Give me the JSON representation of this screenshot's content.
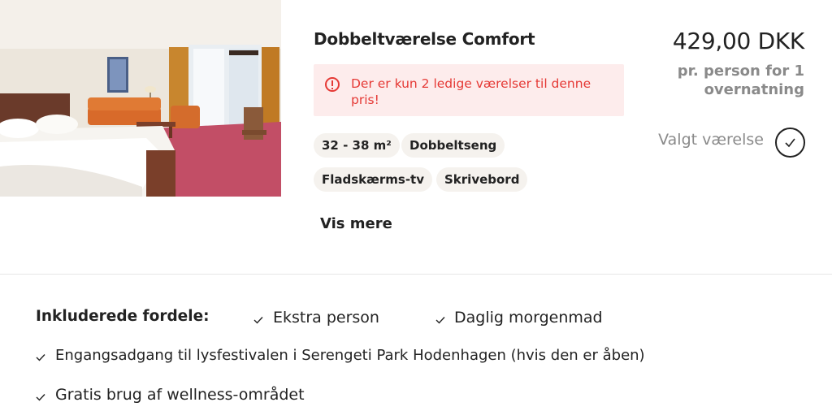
{
  "room": {
    "title": "Dobbeltværelse Comfort",
    "image_alt": "Hotelværelse med dobbeltseng",
    "alert": {
      "icon": "alert-circle-icon",
      "text": "Der er kun 2 ledige værelser til denne pris!",
      "color": "#e53935",
      "background": "#fdecec"
    },
    "features": [
      "32 - 38 m²",
      "Dobbeltseng",
      "Fladskærms-tv",
      "Skrivebord"
    ],
    "show_more_label": "Vis mere",
    "price": "429,00 DKK",
    "price_note": "pr. person for 1 overnatning",
    "selected_label": "Valgt værelse",
    "selected": true
  },
  "benefits": {
    "heading": "Inkluderede fordele:",
    "items": [
      "Ekstra person",
      "Daglig morgenmad",
      "Engangsadgang til lysfestivalen i Serengeti Park Hodenhagen (hvis den er åben)",
      "Gratis brug af wellness-området"
    ]
  }
}
